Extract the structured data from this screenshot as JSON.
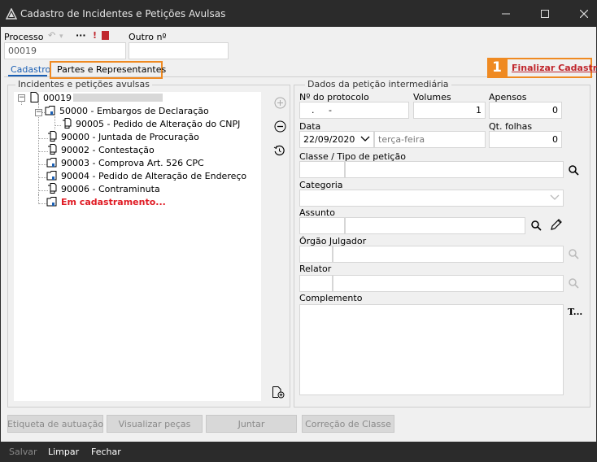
{
  "window": {
    "title": "Cadastro de Incidentes e Petições Avulsas"
  },
  "header": {
    "processo_label": "Processo",
    "processo_value": "00019",
    "outro_label": "Outro nº",
    "outro_value": ""
  },
  "tabs": [
    {
      "label": "Cadastro",
      "active": true
    },
    {
      "label": "Partes e Representantes",
      "active": false
    }
  ],
  "callout": {
    "number": "1",
    "link_label": "Finalizar Cadastro",
    "color": "#ef8a22"
  },
  "left_panel": {
    "title": "Incidentes e petições avulsas",
    "tree": {
      "root": "00019",
      "items": [
        {
          "label": "50000 - Embargos de Declaração",
          "level": 1,
          "expandable": true
        },
        {
          "label": "90005 - Pedido de Alteração do CNPJ",
          "level": 2
        },
        {
          "label": "90000 - Juntada de Procuração",
          "level": 1
        },
        {
          "label": "90002 - Contestação",
          "level": 1
        },
        {
          "label": "90003 - Comprova Art. 526 CPC",
          "level": 1
        },
        {
          "label": "90004 - Pedido de Alteração de Endereço",
          "level": 1
        },
        {
          "label": "90006 - Contraminuta",
          "level": 1
        },
        {
          "label": "Em cadastramento...",
          "level": 1,
          "highlight": true
        }
      ]
    }
  },
  "right_panel": {
    "title": "Dados da petição intermediária",
    "protocolo_label": "Nº do protocolo",
    "protocolo_value": ". -",
    "volumes_label": "Volumes",
    "volumes_value": "1",
    "apensos_label": "Apensos",
    "apensos_value": "0",
    "data_label": "Data",
    "data_value": "22/09/2020",
    "weekday_value": "terça-feira",
    "qt_folhas_label": "Qt. folhas",
    "qt_folhas_value": "0",
    "classe_label": "Classe / Tipo de petição",
    "categoria_label": "Categoria",
    "assunto_label": "Assunto",
    "orgao_label": "Órgão Julgador",
    "relator_label": "Relator",
    "complemento_label": "Complemento"
  },
  "buttons": {
    "etiqueta": "Etiqueta de autuação",
    "visualizar": "Visualizar peças",
    "juntar": "Juntar",
    "correcao": "Correção de Classe"
  },
  "footer": {
    "salvar": "Salvar",
    "limpar": "Limpar",
    "fechar": "Fechar"
  }
}
